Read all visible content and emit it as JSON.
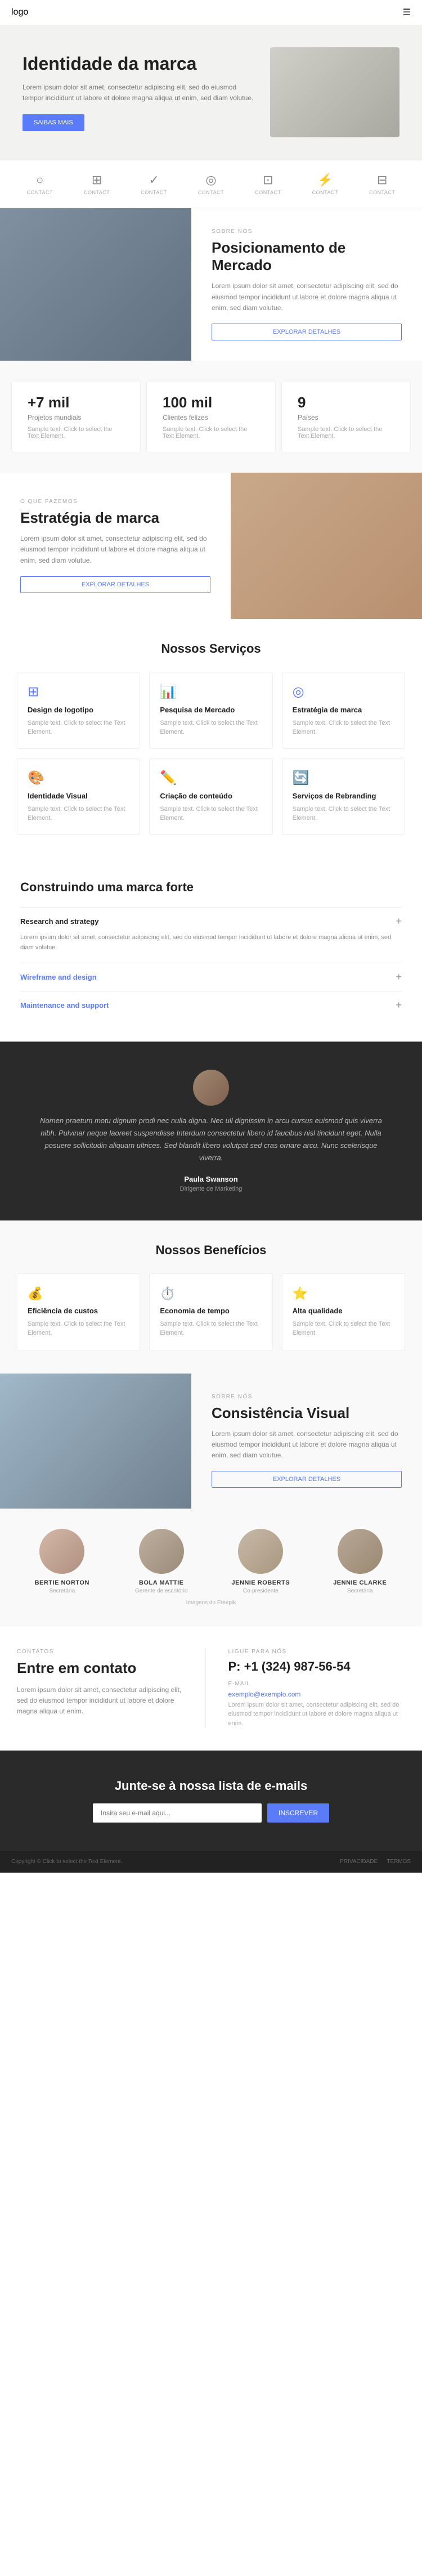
{
  "nav": {
    "logo": "logo",
    "menu_icon": "☰"
  },
  "hero": {
    "title": "Identidade da marca",
    "description": "Lorem ipsum dolor sit amet, consectetur adipiscing elit, sed do eiusmod tempor incididunt ut labore et dolore magna aliqua ut enim, sed diam volutue.",
    "button": "SAIBAS MAIS"
  },
  "icons_row": [
    {
      "icon": "○",
      "label": "CONTACT"
    },
    {
      "icon": "⊞",
      "label": "CONTACT"
    },
    {
      "icon": "✓",
      "label": "CONTACT"
    },
    {
      "icon": "◎",
      "label": "CONTACT"
    },
    {
      "icon": "⊡",
      "label": "CONTACT"
    },
    {
      "icon": "⚡",
      "label": "CONTACT"
    },
    {
      "icon": "⊟",
      "label": "CONTACT"
    }
  ],
  "sobre": {
    "label": "SOBRE NÓS",
    "title": "Posicionamento de Mercado",
    "description": "Lorem ipsum dolor sit amet, consectetur adipiscing elit, sed do eiusmod tempor incididunt ut labore et dolore magna aliqua ut enim, sed diam volutue.",
    "button": "EXPLORAR DETALHES"
  },
  "stats": [
    {
      "number": "+7 mil",
      "label": "Projetos mundiais",
      "desc": "Sample text. Click to select the Text Element."
    },
    {
      "number": "100 mil",
      "label": "Clientes felizes",
      "desc": "Sample text. Click to select the Text Element."
    },
    {
      "number": "9",
      "label": "Países",
      "desc": "Sample text. Click to select the Text Element."
    }
  ],
  "what": {
    "label": "O QUE FAZEMOS",
    "title": "Estratégia de marca",
    "description": "Lorem ipsum dolor sit amet, consectetur adipiscing elit, sed do eiusmod tempor incididunt ut labore et dolore magna aliqua ut enim, sed diam volutue.",
    "button": "EXPLORAR DETALHES"
  },
  "services": {
    "title": "Nossos Serviços",
    "items": [
      {
        "icon": "⊞",
        "name": "Design de logotipo",
        "desc": "Sample text. Click to select the Text Element."
      },
      {
        "icon": "📊",
        "name": "Pesquisa de Mercado",
        "desc": "Sample text. Click to select the Text Element."
      },
      {
        "icon": "◎",
        "name": "Estratégia de marca",
        "desc": "Sample text. Click to select the Text Element."
      },
      {
        "icon": "🎨",
        "name": "Identidade Visual",
        "desc": "Sample text. Click to select the Text Element."
      },
      {
        "icon": "✏️",
        "name": "Criação de conteúdo",
        "desc": "Sample text. Click to select the Text Element."
      },
      {
        "icon": "🔄",
        "name": "Serviços de Rebranding",
        "desc": "Sample text. Click to select the Text Element."
      }
    ]
  },
  "building": {
    "title": "Construindo uma marca forte",
    "items": [
      {
        "label": "Research and strategy",
        "open": true,
        "content": "Lorem ipsum dolor sit amet, consectetur adipiscing elit, sed do eiusmod tempor incididunt ut labore et dolore magna aliqua ut enim, sed diam volutue."
      },
      {
        "label": "Wireframe and design",
        "open": false,
        "content": ""
      },
      {
        "label": "Maintenance and support",
        "open": false,
        "content": ""
      }
    ]
  },
  "testimonial": {
    "text": "Nomen praetum motu dignum prodi nec nulla digna. Nec ull dignissim in arcu cursus euismod quis viverra nibh. Pulvinar neque laoreet suspendisse Interdum consectetur libero id faucibus nisl tincidunt eget. Nulla posuere sollicitudin aliquam ultrices. Sed blandit libero volutpat sed cras ornare arcu. Nunc scelerisque viverra.",
    "name": "Paula Swanson",
    "role": "Dirigente de Marketing"
  },
  "benefits": {
    "title": "Nossos Benefícios",
    "items": [
      {
        "icon": "💰",
        "name": "Eficiência de custos",
        "desc": "Sample text. Click to select the Text Element."
      },
      {
        "icon": "⏱️",
        "name": "Economia de tempo",
        "desc": "Sample text. Click to select the Text Element."
      },
      {
        "icon": "⭐",
        "name": "Alta qualidade",
        "desc": "Sample text. Click to select the Text Element."
      }
    ]
  },
  "consistencia": {
    "label": "SOBRE NÓS",
    "title": "Consistência Visual",
    "description": "Lorem ipsum dolor sit amet, consectetur adipiscing elit, sed do eiusmod tempor incididunt ut labore et dolore magna aliqua ut enim, sed diam volutue.",
    "button": "EXPLORAR DETALHES"
  },
  "team": {
    "members": [
      {
        "name": "BERTIE NORTON",
        "role": "Secretária"
      },
      {
        "name": "BOLA MATTIE",
        "role": "Gerente de escritório"
      },
      {
        "name": "JENNIE ROBERTS",
        "role": "Co-presidente"
      },
      {
        "name": "JENNIE CLARKE",
        "role": "Secretária"
      }
    ],
    "images_label": "Imagens do Freepik"
  },
  "contact": {
    "left_label": "CONTATOS",
    "left_title": "Entre em contato",
    "left_desc": "Lorem ipsum dolor sit amet, consectetur adipiscing elit, sed do eiusmod tempor incididunt ut labore et dolore magna aliqua ut enim.",
    "right_label": "LIGUE PARA NÓS",
    "phone": "P: +1 (324) 987-56-54",
    "email_label": "E-MAIL",
    "email": "exemplo@exemplo.com",
    "email_desc": "Lorem ipsum dolor sit amet, consectetur adipiscing elit, sed do eiusmod tempor incididunt ut labore et dolore magna aliqua ut enim."
  },
  "newsletter": {
    "title": "Junte-se à nossa lista de e-mails",
    "input_placeholder": "Insira seu e-mail aqui...",
    "button": "INSCREVER"
  },
  "footer": {
    "copyright": "Copyright © Click to select the Text Element.",
    "links": [
      "PRIVACIDADE",
      "TERMOS"
    ]
  }
}
